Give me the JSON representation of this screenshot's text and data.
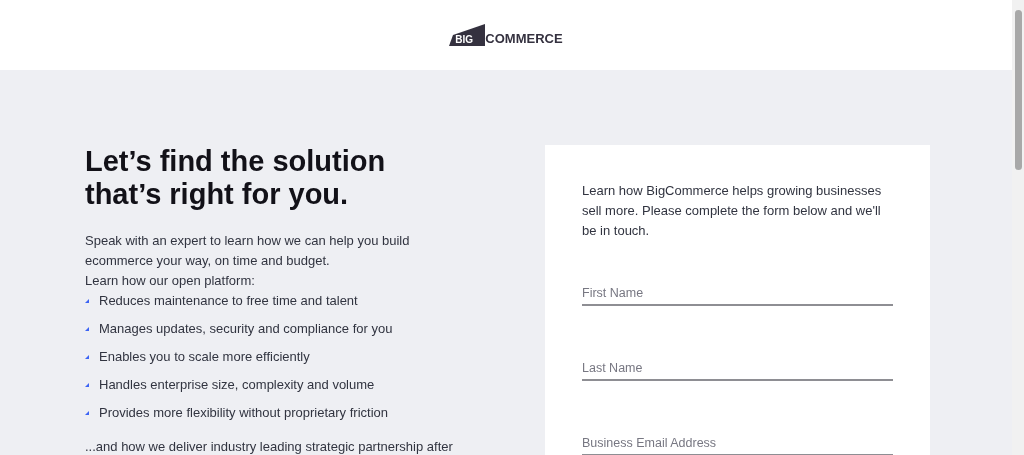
{
  "logo": {
    "mark_text": "BIG",
    "text": "COMMERCE"
  },
  "hero": {
    "heading": "Let’s find the solution that’s right for you.",
    "intro": "Speak with an expert to learn how we can help you build ecommerce your way, on time and budget.",
    "lead": "Learn how our open platform:",
    "bullets": [
      "Reduces maintenance to free time and talent",
      "Manages updates, security and compliance for you",
      "Enables you to scale more efficiently",
      "Handles enterprise size, complexity and volume",
      "Provides more flexibility without proprietary friction"
    ],
    "closing": "...and how we deliver industry leading strategic partnership after"
  },
  "form": {
    "intro": "Learn how BigCommerce helps growing businesses sell more. Please complete the form below and we'll be in touch.",
    "fields": [
      {
        "placeholder": "First Name"
      },
      {
        "placeholder": "Last Name"
      },
      {
        "placeholder": "Business Email Address"
      }
    ]
  }
}
